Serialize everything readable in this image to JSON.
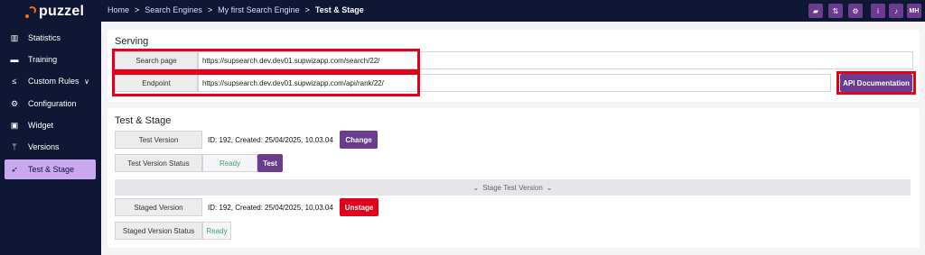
{
  "brand": {
    "name": "puzzel",
    "accent": "#ff6a1a"
  },
  "sidebar": {
    "items": [
      {
        "label": "Statistics",
        "icon": "bar-chart-icon",
        "glyph": "▥"
      },
      {
        "label": "Training",
        "icon": "book-icon",
        "glyph": "▬"
      },
      {
        "label": "Custom Rules",
        "icon": "less-equal-icon",
        "glyph": "≤"
      },
      {
        "label": "Configuration",
        "icon": "settings-icon",
        "glyph": "⚙"
      },
      {
        "label": "Widget",
        "icon": "widget-icon",
        "glyph": "▣"
      },
      {
        "label": "Versions",
        "icon": "branch-icon",
        "glyph": "ᛘ"
      },
      {
        "label": "Test & Stage",
        "icon": "rocket-icon",
        "glyph": "➶"
      }
    ],
    "custom_rules_chevron": "∨"
  },
  "header": {
    "breadcrumb": [
      "Home",
      "Search Engines",
      "My first Search Engine",
      "Test & Stage"
    ],
    "separator": ">",
    "toolbar": [
      {
        "icon": "folder-icon",
        "glyph": "▰"
      },
      {
        "icon": "sort-icon",
        "glyph": "⇅"
      },
      {
        "icon": "gear-icon",
        "glyph": "⚙"
      },
      {
        "icon": "info-icon",
        "glyph": "i"
      },
      {
        "icon": "bell-icon",
        "glyph": "♪"
      }
    ],
    "user_initials": "MH"
  },
  "serving": {
    "title": "Serving",
    "search_page_label": "Search page",
    "search_page_url": "https://supsearch.dev.dev01.supwizapp.com/search/22/",
    "endpoint_label": "Endpoint",
    "endpoint_url": "https://supsearch.dev.dev01.supwizapp.com/api/rank/22/",
    "api_doc_label": "API Documentation"
  },
  "test_stage": {
    "title": "Test & Stage",
    "test_version_label": "Test Version",
    "test_version_value": "ID: 192, Created: 25/04/2025, 10.03.04",
    "change_label": "Change",
    "test_status_label": "Test Version Status",
    "test_status_value": "Ready",
    "test_button_label": "Test",
    "stage_bar_label": "Stage Test Version",
    "stage_bar_icon": "double-chevron-down-icon",
    "stage_bar_glyph": "⌄",
    "staged_version_label": "Staged Version",
    "staged_version_value": "ID: 192, Created: 25/04/2025, 10.03.04",
    "unstage_label": "Unstage",
    "staged_status_label": "Staged Version Status",
    "staged_status_value": "Ready"
  },
  "colors": {
    "nav_bg": "#101734",
    "button_purple": "#6a3b8f",
    "button_red": "#e3001b",
    "active_nav": "#c9a8f0",
    "ready_green": "#3aa37a"
  }
}
